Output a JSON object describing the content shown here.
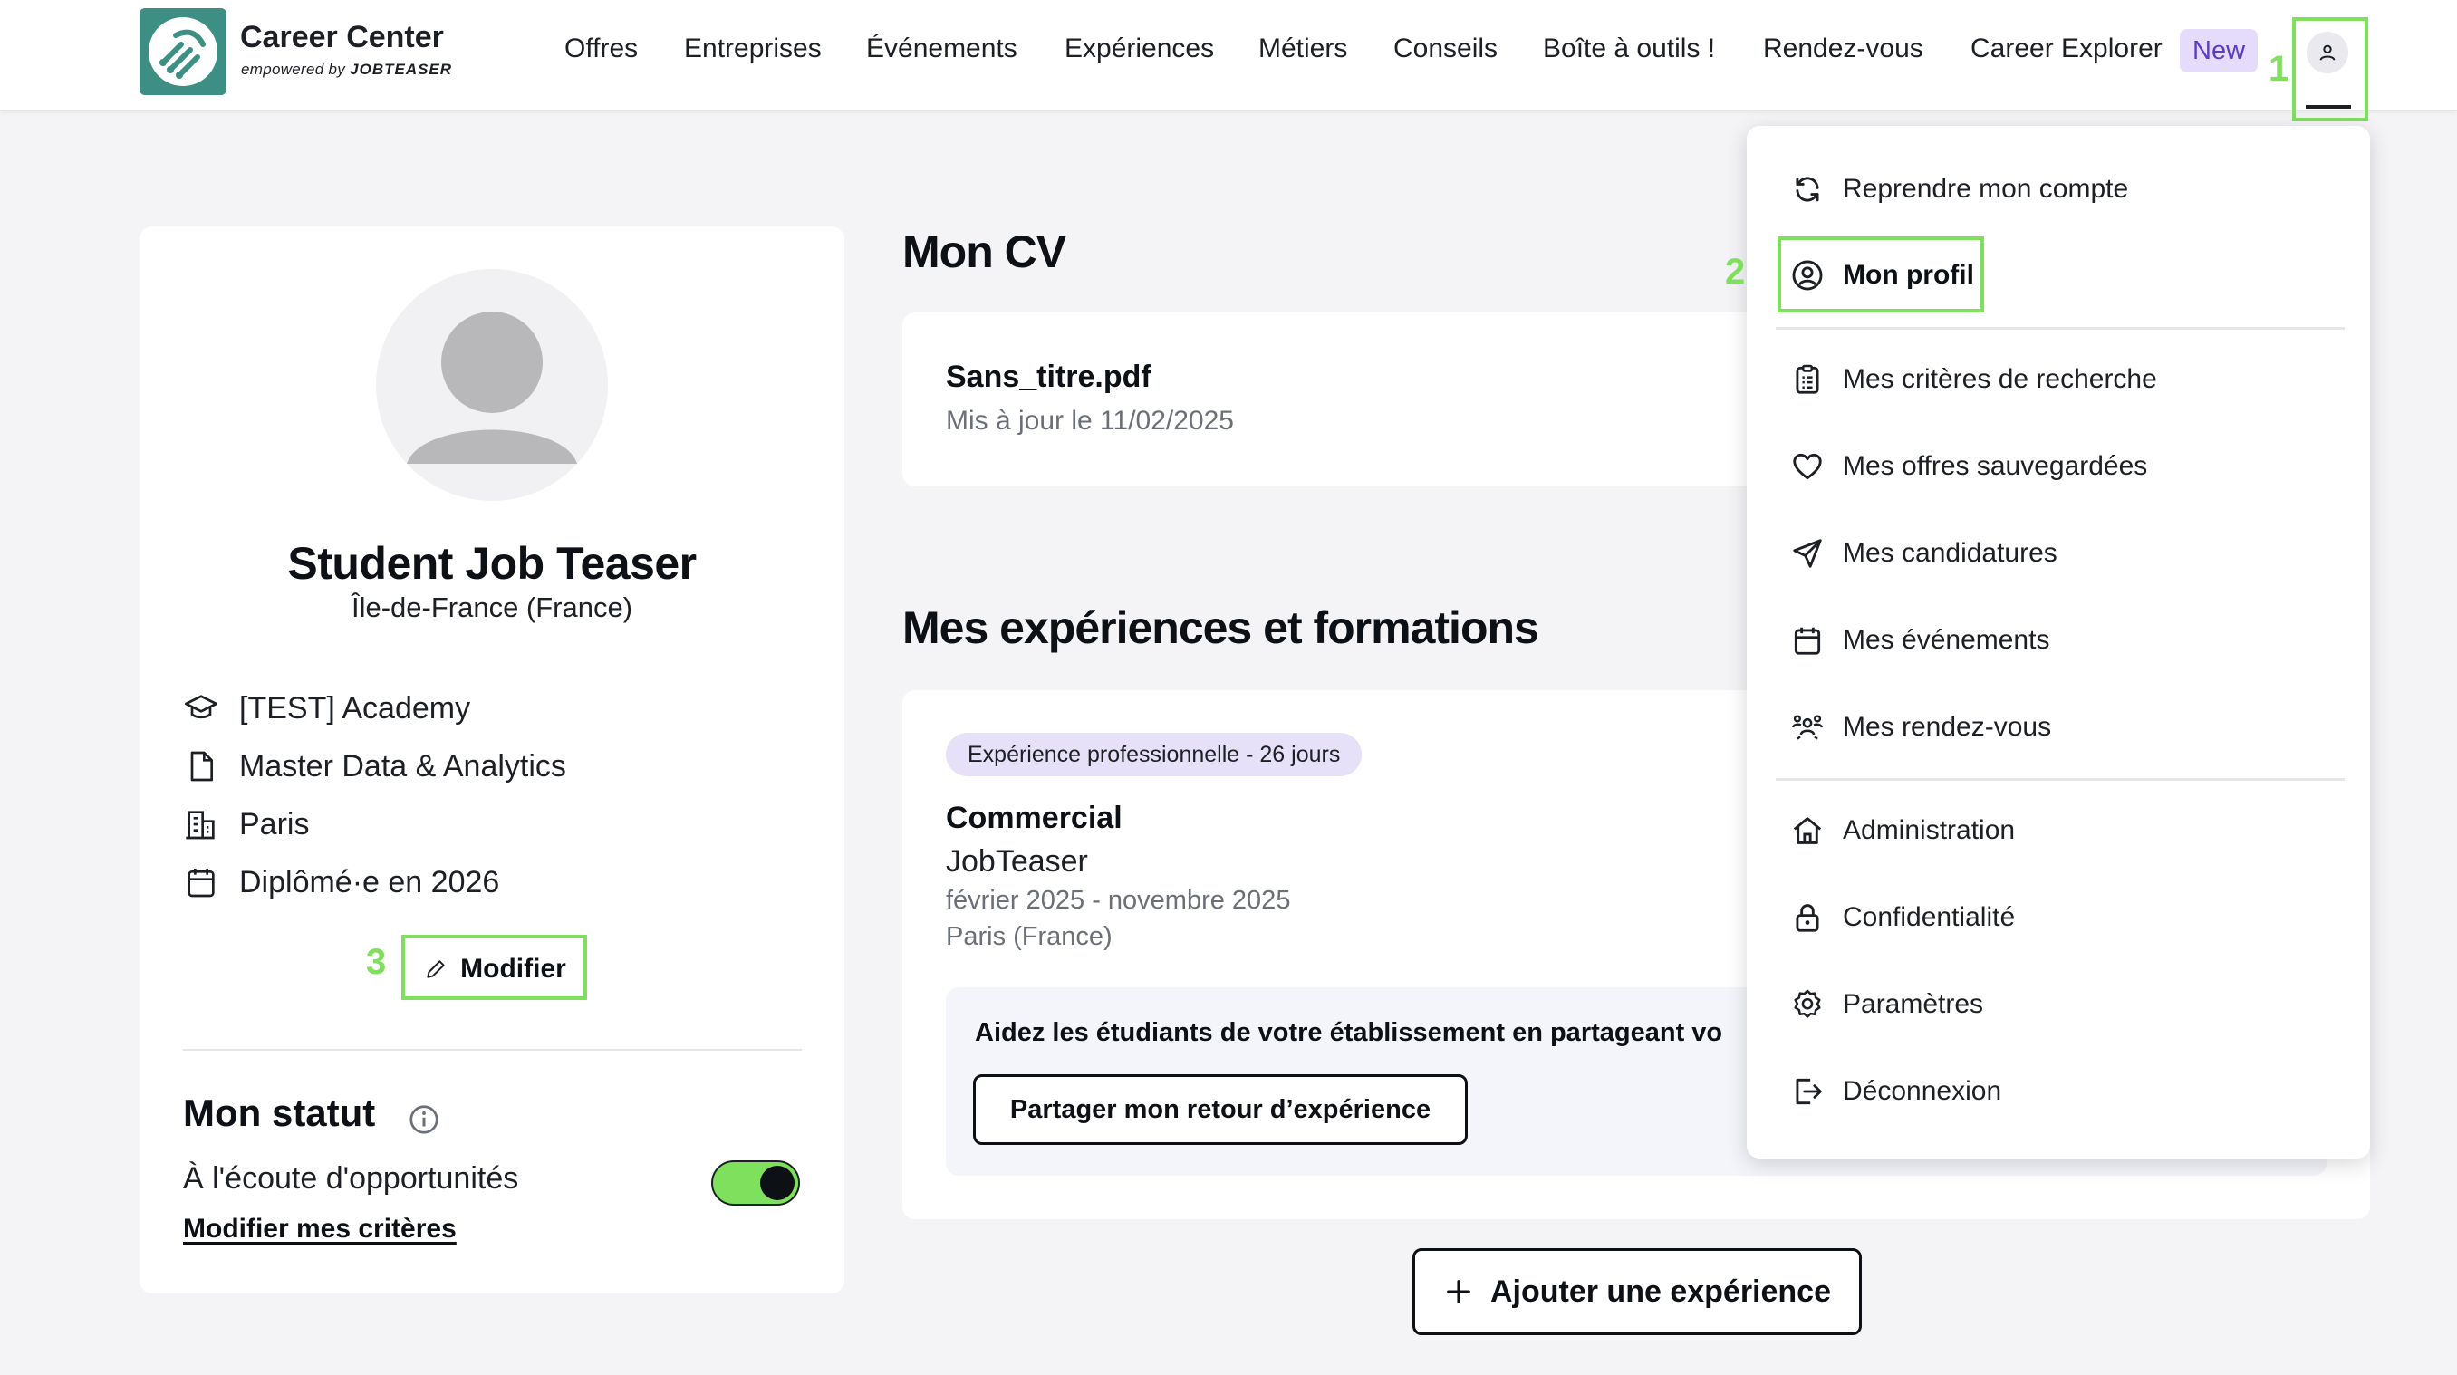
{
  "brand": {
    "title": "Career Center",
    "subtitle_prefix": "empowered by",
    "subtitle_brand": "JOBTEASER"
  },
  "nav": {
    "items": [
      "Offres",
      "Entreprises",
      "Événements",
      "Expériences",
      "Métiers",
      "Conseils",
      "Boîte à outils !",
      "Rendez-vous",
      "Career Explorer"
    ],
    "new_badge": "New",
    "account_icon": "user-icon"
  },
  "annotations": {
    "marker_1": "1",
    "marker_2": "2",
    "marker_3": "3",
    "highlight_color": "#7ee05c"
  },
  "profile": {
    "name": "Student Job Teaser",
    "location": "Île-de-France (France)",
    "details": [
      {
        "icon": "graduation-cap-icon",
        "text": "[TEST] Academy"
      },
      {
        "icon": "document-icon",
        "text": "Master Data & Analytics"
      },
      {
        "icon": "building-icon",
        "text": "Paris"
      },
      {
        "icon": "calendar-icon",
        "text": "Diplômé·e en 2026"
      }
    ],
    "edit_label": "Modifier",
    "status_title": "Mon statut",
    "status_text": "À l'écoute d'opportunités",
    "status_toggle_on": true,
    "criteria_link": "Modifier mes critères"
  },
  "cv": {
    "title": "Mon CV",
    "file_name": "Sans_titre.pdf",
    "updated": "Mis à jour le 11/02/2025"
  },
  "experiences": {
    "title": "Mes expériences et formations",
    "items": [
      {
        "tag": "Expérience professionnelle - 26 jours",
        "role": "Commercial",
        "company": "JobTeaser",
        "dates": "février 2025 - novembre 2025",
        "place": "Paris (France)",
        "feedback_prompt": "Aidez les étudiants de votre établissement en partageant vo",
        "feedback_button": "Partager mon retour d’expérience"
      }
    ],
    "add_button": "Ajouter une expérience"
  },
  "account_menu": {
    "items": [
      {
        "icon": "refresh-icon",
        "label": "Reprendre mon compte"
      },
      {
        "icon": "user-circle-icon",
        "label": "Mon profil",
        "active": true
      },
      {
        "icon": "clipboard-icon",
        "label": "Mes critères de recherche"
      },
      {
        "icon": "heart-icon",
        "label": "Mes offres sauvegardées"
      },
      {
        "icon": "send-icon",
        "label": "Mes candidatures"
      },
      {
        "icon": "calendar-icon",
        "label": "Mes événements"
      },
      {
        "icon": "people-icon",
        "label": "Mes rendez-vous"
      },
      {
        "icon": "home-icon",
        "label": "Administration"
      },
      {
        "icon": "lock-icon",
        "label": "Confidentialité"
      },
      {
        "icon": "gear-icon",
        "label": "Paramètres"
      },
      {
        "icon": "logout-icon",
        "label": "Déconnexion"
      }
    ]
  },
  "colors": {
    "accent_green": "#7ee05c",
    "brand_teal": "#3d8f83",
    "badge_purple_bg": "#e4dcfa",
    "badge_purple_text": "#5b3cc4",
    "tag_bg": "#e6e0f9"
  }
}
